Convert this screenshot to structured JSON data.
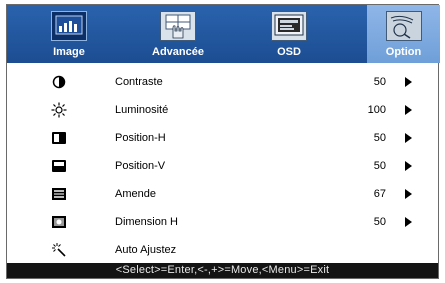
{
  "tabs": [
    {
      "label": "Image",
      "icon": "image-icon"
    },
    {
      "label": "Advancée",
      "icon": "advanced-icon"
    },
    {
      "label": "OSD",
      "icon": "osd-icon"
    },
    {
      "label": "Option",
      "icon": "option-icon"
    }
  ],
  "rows": [
    {
      "label": "Contraste",
      "value": "50",
      "icon": "contrast-icon"
    },
    {
      "label": "Luminosité",
      "value": "100",
      "icon": "brightness-icon"
    },
    {
      "label": "Position-H",
      "value": "50",
      "icon": "h-position-icon"
    },
    {
      "label": "Position-V",
      "value": "50",
      "icon": "v-position-icon"
    },
    {
      "label": "Amende",
      "value": "67",
      "icon": "fine-icon"
    },
    {
      "label": "Dimension H",
      "value": "50",
      "icon": "h-size-icon"
    },
    {
      "label": "Auto Ajustez",
      "value": "",
      "icon": "auto-adjust-icon"
    }
  ],
  "status_bar": "<Select>=Enter,<-,+>=Move,<Menu>=Exit",
  "colors": {
    "tab_bar": "#1f55a0",
    "status_bar": "#141414",
    "active_tab_icon": "#0b2f66"
  }
}
